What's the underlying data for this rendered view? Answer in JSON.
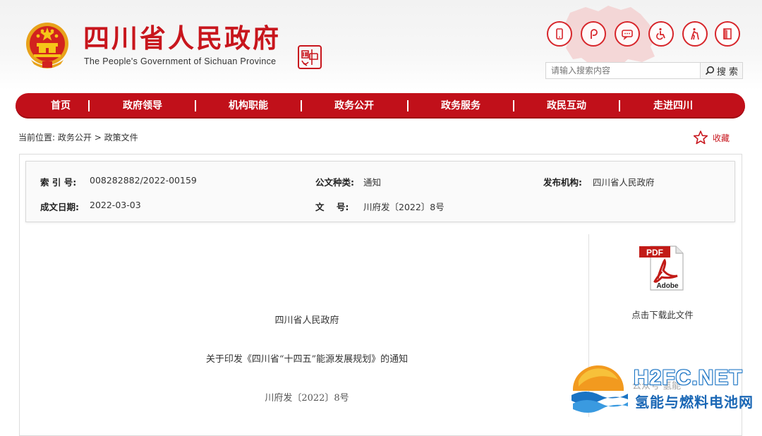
{
  "header": {
    "title": "四川省人民政府",
    "subtitle": "The People's Government of Sichuan Province",
    "tools": [
      {
        "icon": "mobile-icon"
      },
      {
        "icon": "weibo-icon"
      },
      {
        "icon": "chat-icon"
      },
      {
        "icon": "wheelchair-icon"
      },
      {
        "icon": "elderly-icon"
      },
      {
        "icon": "exit-icon"
      }
    ],
    "search_placeholder": "请输入搜索内容",
    "search_button": "搜 索"
  },
  "nav": {
    "items": [
      {
        "label": "首页"
      },
      {
        "label": "政府领导"
      },
      {
        "label": "机构职能"
      },
      {
        "label": "政务公开"
      },
      {
        "label": "政务服务"
      },
      {
        "label": "政民互动"
      },
      {
        "label": "走进四川"
      }
    ]
  },
  "breadcrumb": {
    "prefix": "当前位置:",
    "items": [
      "政务公开",
      "政策文件"
    ],
    "separator": ">"
  },
  "favorite_label": "收藏",
  "meta": {
    "index_label": "索 引 号:",
    "index_value": "008282882/2022-00159",
    "type_label": "公文种类:",
    "type_value": "通知",
    "publisher_label": "发布机构:",
    "publisher_value": "四川省人民政府",
    "date_label": "成文日期:",
    "date_value": "2022-03-03",
    "docno_label": "文    号:",
    "docno_value": "川府发〔2022〕8号"
  },
  "download": {
    "pdf_text": "PDF",
    "adobe_text": "Adobe",
    "label": "点击下载此文件"
  },
  "document": {
    "issuer": "四川省人民政府",
    "title": "关于印发《四川省“十四五”能源发展规划》的通知",
    "number": "川府发〔2022〕8号"
  },
  "watermark": {
    "en": "H2FC.NET",
    "cn": "氢能与燃料电池网",
    "tag": "公众号·氢能"
  },
  "colors": {
    "brand_red": "#c8161d",
    "nav_red": "#c1101a",
    "watermark_blue": "#1a67b5"
  }
}
